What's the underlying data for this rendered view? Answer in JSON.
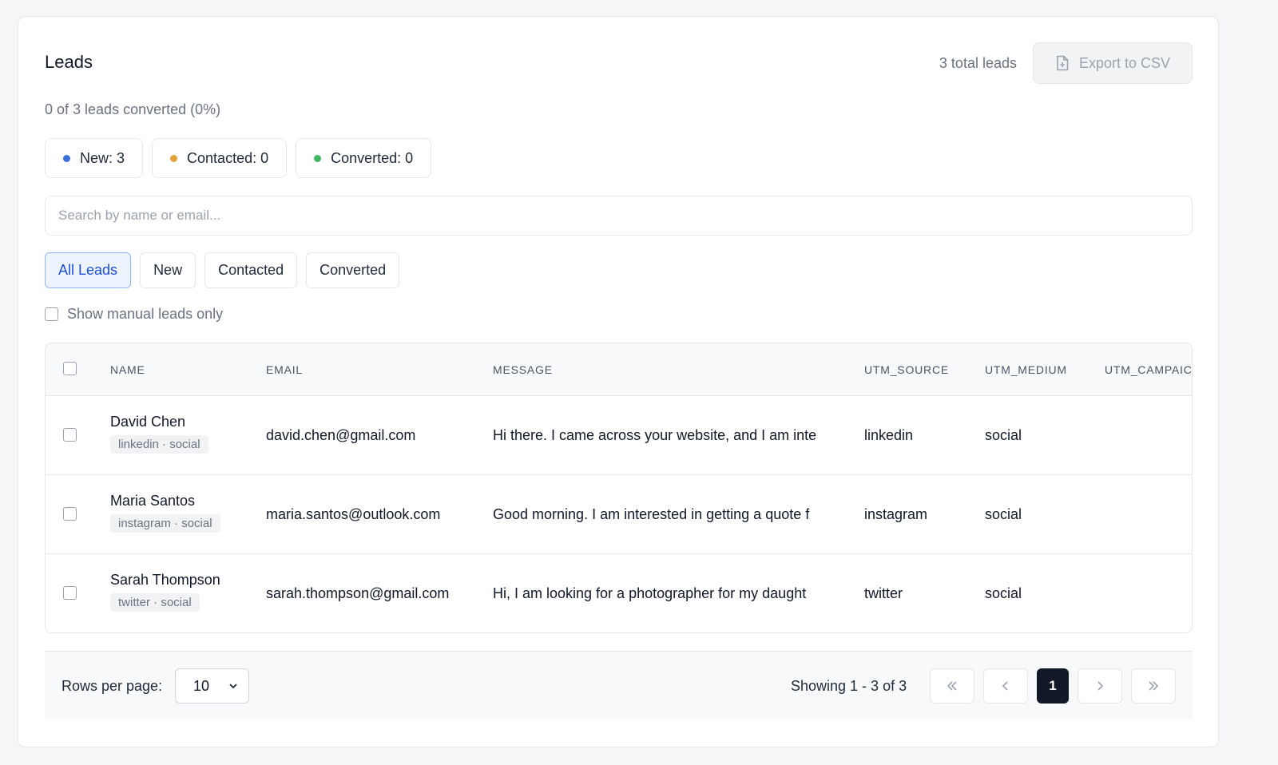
{
  "header": {
    "title": "Leads",
    "total_leads": "3 total leads",
    "export_label": "Export to CSV",
    "converted_summary": "0 of 3 leads converted (0%)"
  },
  "status_pills": [
    {
      "label": "New: 3",
      "color": "#3b6fdb"
    },
    {
      "label": "Contacted: 0",
      "color": "#e3a33b"
    },
    {
      "label": "Converted: 0",
      "color": "#3fb560"
    }
  ],
  "search": {
    "placeholder": "Search by name or email..."
  },
  "filter_tabs": [
    {
      "label": "All Leads",
      "active": true
    },
    {
      "label": "New",
      "active": false
    },
    {
      "label": "Contacted",
      "active": false
    },
    {
      "label": "Converted",
      "active": false
    }
  ],
  "manual_filter": {
    "label": "Show manual leads only"
  },
  "table": {
    "columns": [
      "NAME",
      "EMAIL",
      "MESSAGE",
      "UTM_SOURCE",
      "UTM_MEDIUM",
      "UTM_CAMPAIC"
    ],
    "rows": [
      {
        "name": "David Chen",
        "tag": "linkedin · social",
        "email": "david.chen@gmail.com",
        "message": "Hi there. I came across your website, and I am inte",
        "utm_source": "linkedin",
        "utm_medium": "social"
      },
      {
        "name": "Maria Santos",
        "tag": "instagram · social",
        "email": "maria.santos@outlook.com",
        "message": "Good morning. I am interested in getting a quote f",
        "utm_source": "instagram",
        "utm_medium": "social"
      },
      {
        "name": "Sarah Thompson",
        "tag": "twitter · social",
        "email": "sarah.thompson@gmail.com",
        "message": "Hi, I am looking for a photographer for my daught",
        "utm_source": "twitter",
        "utm_medium": "social"
      }
    ]
  },
  "footer": {
    "rows_per_page_label": "Rows per page:",
    "rows_per_page_value": "10",
    "showing": "Showing 1 - 3 of 3",
    "current_page": "1"
  },
  "icons": {
    "export": "file-export-icon",
    "first": "chevrons-left-icon",
    "prev": "chevron-left-icon",
    "next": "chevron-right-icon",
    "last": "chevrons-right-icon",
    "select": "chevron-down-icon"
  },
  "colors": {
    "accent": "#1d4ed8",
    "current_page_bg": "#111827"
  }
}
